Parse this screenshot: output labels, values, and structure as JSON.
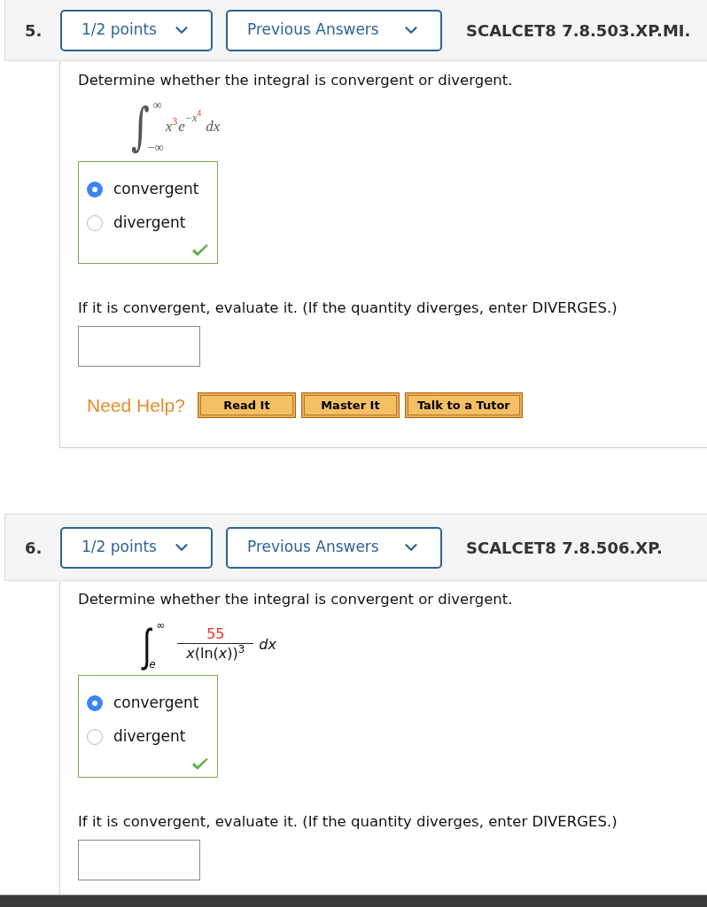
{
  "questions": [
    {
      "number": "5.",
      "points": "1/2 points",
      "history": "Previous Answers",
      "code": "SCALCET8 7.8.503.XP.MI.",
      "prompt": "Determine whether the integral is convergent or divergent.",
      "integral": {
        "kind": "power",
        "symbol": "∫",
        "upper": "∞",
        "lower": "−∞",
        "base": "x",
        "power": "3",
        "exp_base": "e",
        "exponent": "−x",
        "exponent_power": "4",
        "differential": "dx"
      },
      "choices": [
        {
          "label": "convergent",
          "selected": true
        },
        {
          "label": "divergent",
          "selected": false
        }
      ],
      "correct": true,
      "evaluate_prompt": "If it is convergent, evaluate it. (If the quantity diverges, enter DIVERGES.)",
      "help": {
        "label": "Need Help?",
        "buttons": [
          "Read It",
          "Master It",
          "Talk to a Tutor"
        ]
      }
    },
    {
      "number": "6.",
      "points": "1/2 points",
      "history": "Previous Answers",
      "code": "SCALCET8 7.8.506.XP.",
      "prompt": "Determine whether the integral is convergent or divergent.",
      "integral": {
        "kind": "fraction",
        "symbol": "∫",
        "upper": "∞",
        "lower": "e",
        "numerator": "55",
        "denominator": "*x*(ln(*x*))$^{3}$",
        "differential": "dx"
      },
      "choices": [
        {
          "label": "convergent",
          "selected": true
        },
        {
          "label": "divergent",
          "selected": false
        }
      ],
      "correct": true,
      "evaluate_prompt": "If it is convergent, evaluate it. (If the quantity diverges, enter DIVERGES.)"
    }
  ]
}
